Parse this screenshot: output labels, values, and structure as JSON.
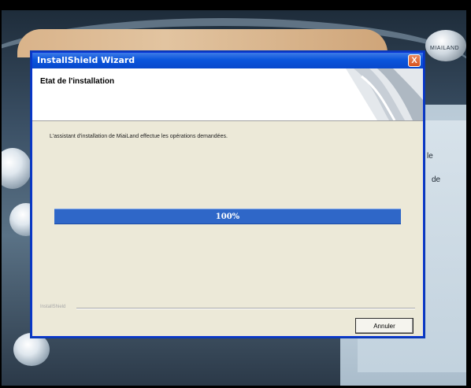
{
  "window": {
    "title": "InstallShield Wizard",
    "close_glyph": "X"
  },
  "header": {
    "title": "Etat de l'installation"
  },
  "main": {
    "message": "L'assistant d'installation de MiaiLand effectue les opérations demandées.",
    "progress_percent": 100,
    "progress_label": "100%"
  },
  "footer": {
    "brand": "InstallShield",
    "cancel_label": "Annuler"
  },
  "background": {
    "logo_text": "MIAILAND",
    "side_texts": [
      "le",
      "de"
    ]
  },
  "colors": {
    "titlebar": "#0a55dc",
    "dialog_bg": "#ece9d8",
    "progress": "#2f67c8",
    "close_button": "#d9541e"
  },
  "icons": {
    "close": "close-icon"
  }
}
